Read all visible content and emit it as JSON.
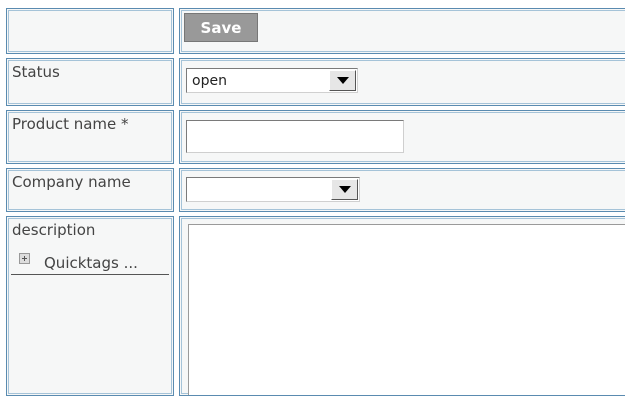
{
  "toolbar": {
    "save_label": "Save"
  },
  "fields": {
    "status": {
      "label": "Status",
      "value": "open"
    },
    "product_name": {
      "label": "Product name *",
      "value": ""
    },
    "company_name": {
      "label": "Company name",
      "value": ""
    },
    "description": {
      "label": "description",
      "quicktags_label": "Quicktags ..."
    }
  },
  "colors": {
    "border": "#5a8bb0",
    "button": "#999999",
    "cell_bg": "#f6f7f7"
  }
}
